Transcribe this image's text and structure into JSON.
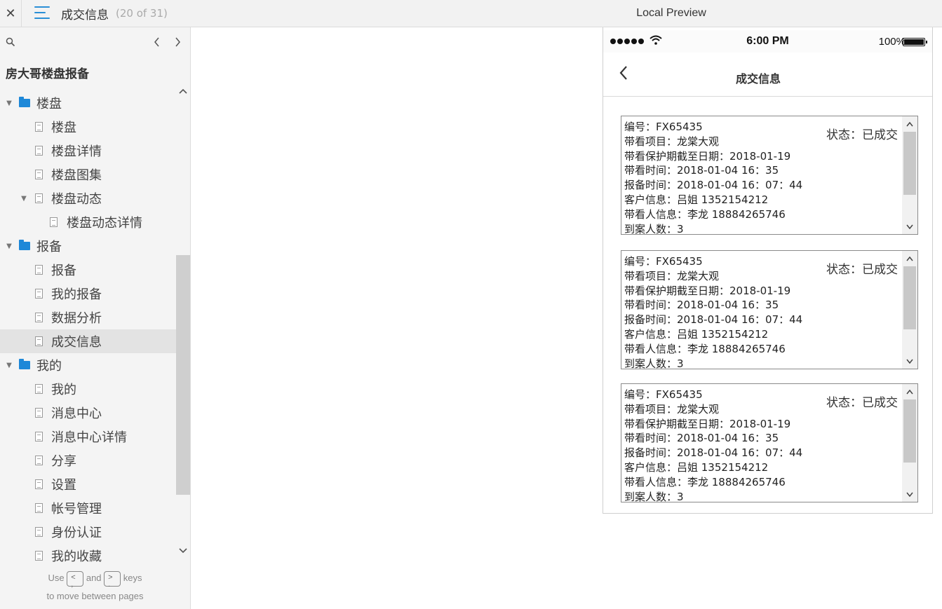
{
  "topbar": {
    "close": "✕",
    "title": "成交信息",
    "count": "(20 of 31)",
    "center": "Local Preview"
  },
  "sidebar": {
    "project": "房大哥楼盘报备",
    "items": [
      {
        "label": "楼盘",
        "type": "folder"
      },
      {
        "label": "楼盘",
        "type": "page"
      },
      {
        "label": "楼盘详情",
        "type": "page"
      },
      {
        "label": "楼盘图集",
        "type": "page"
      },
      {
        "label": "楼盘动态",
        "type": "page"
      },
      {
        "label": "楼盘动态详情",
        "type": "page"
      },
      {
        "label": "报备",
        "type": "folder"
      },
      {
        "label": "报备",
        "type": "page"
      },
      {
        "label": "我的报备",
        "type": "page"
      },
      {
        "label": "数据分析",
        "type": "page"
      },
      {
        "label": "成交信息",
        "type": "page",
        "selected": true
      },
      {
        "label": "我的",
        "type": "folder"
      },
      {
        "label": "我的",
        "type": "page"
      },
      {
        "label": "消息中心",
        "type": "page"
      },
      {
        "label": "消息中心详情",
        "type": "page"
      },
      {
        "label": "分享",
        "type": "page"
      },
      {
        "label": "设置",
        "type": "page"
      },
      {
        "label": "帐号管理",
        "type": "page"
      },
      {
        "label": "身份认证",
        "type": "page"
      },
      {
        "label": "我的收藏",
        "type": "page"
      }
    ],
    "hint": {
      "use": "Use",
      "and": "and",
      "keys": "keys",
      "line2": "to move between pages",
      "key_prev": "<\n,",
      "key_next": ">\n."
    }
  },
  "phone": {
    "status": {
      "time": "6:00 PM",
      "battery": "100%"
    },
    "nav": {
      "title": "成交信息"
    },
    "cards": [
      {
        "status": "状态：已成交",
        "lines": [
          "编号：FX65435",
          "带看项目：龙棠大观",
          "带看保护期截至日期：2018-01-19",
          "带看时间：2018-01-04 16：35",
          "报备时间：2018-01-04 16：07：44",
          "客户信息：吕姐 1352154212",
          "带看人信息：李龙 18884265746",
          "到案人数：3"
        ]
      },
      {
        "status": "状态：已成交",
        "lines": [
          "编号：FX65435",
          "带看项目：龙棠大观",
          "带看保护期截至日期：2018-01-19",
          "带看时间：2018-01-04 16：35",
          "报备时间：2018-01-04 16：07：44",
          "客户信息：吕姐 1352154212",
          "带看人信息：李龙 18884265746",
          "到案人数：3"
        ]
      },
      {
        "status": "状态：已成交",
        "lines": [
          "编号：FX65435",
          "带看项目：龙棠大观",
          "带看保护期截至日期：2018-01-19",
          "带看时间：2018-01-04 16：35",
          "报备时间：2018-01-04 16：07：44",
          "客户信息：吕姐 1352154212",
          "带看人信息：李龙 18884265746",
          "到案人数：3"
        ]
      }
    ]
  }
}
